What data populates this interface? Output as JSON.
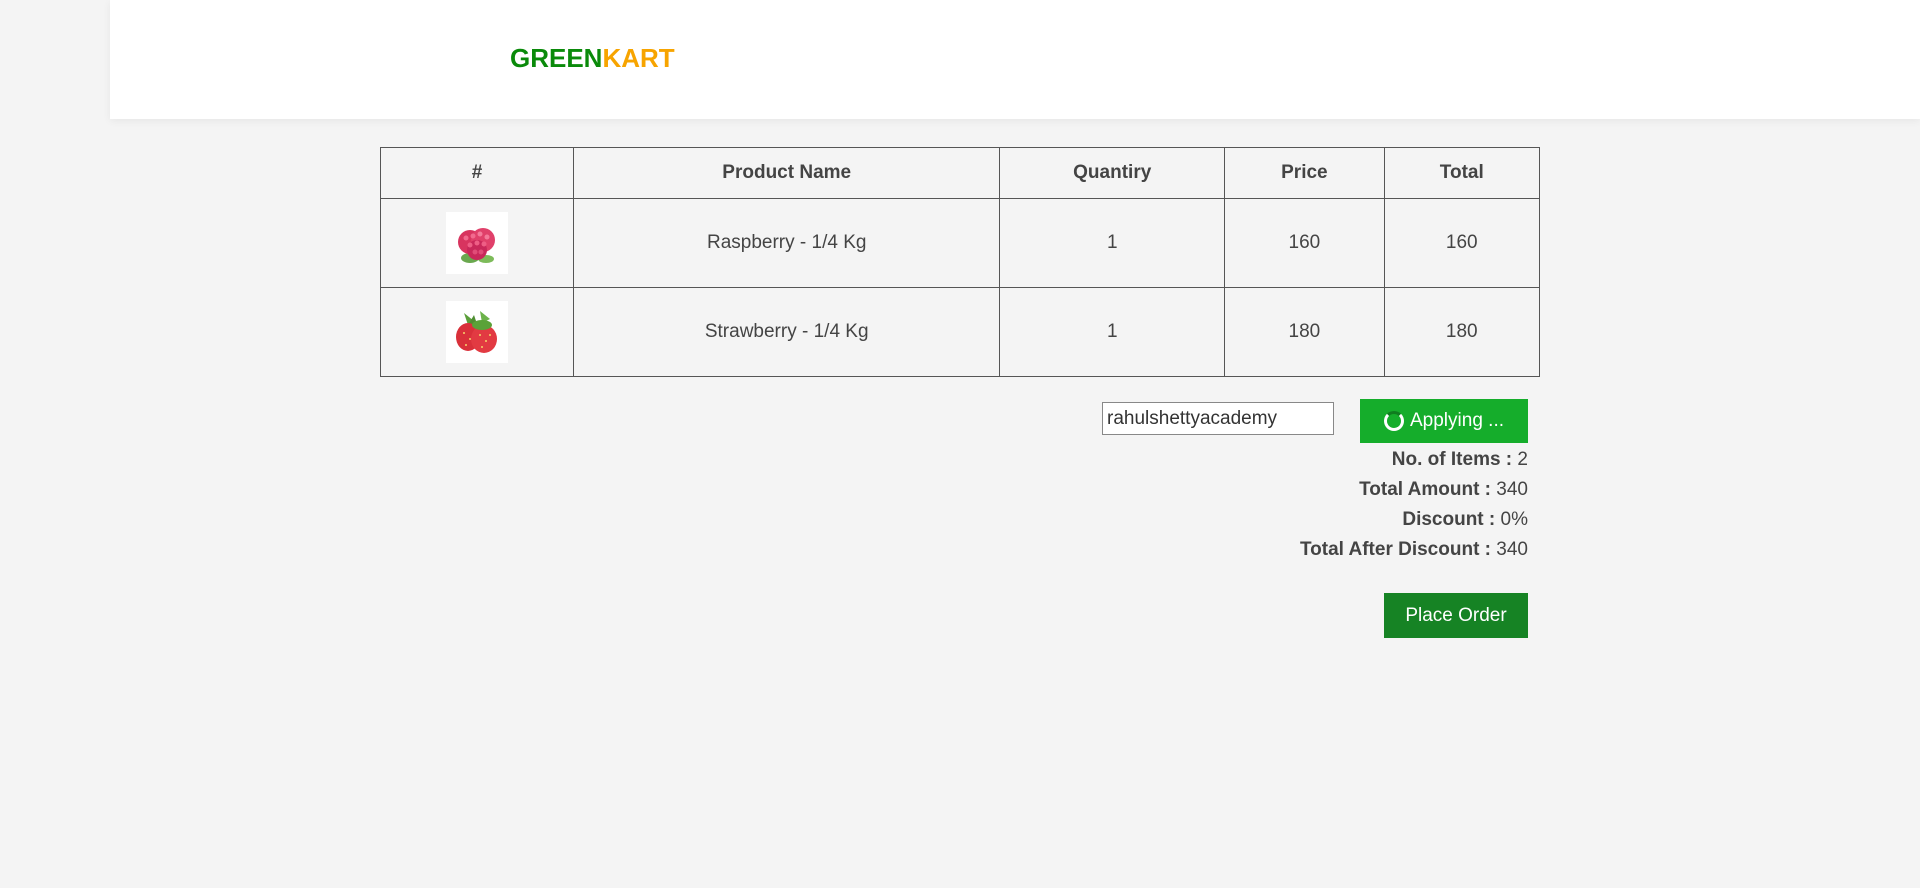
{
  "brand": {
    "part1": "GREEN",
    "part2": "KART",
    "color1": "#0a8a0a",
    "color2": "#f7a400"
  },
  "table": {
    "headers": [
      "#",
      "Product Name",
      "Quantiry",
      "Price",
      "Total"
    ],
    "rows": [
      {
        "image_icon": "raspberry-icon",
        "name": "Raspberry - 1/4 Kg",
        "quantity": "1",
        "price": "160",
        "total": "160"
      },
      {
        "image_icon": "strawberry-icon",
        "name": "Strawberry - 1/4 Kg",
        "quantity": "1",
        "price": "180",
        "total": "180"
      }
    ]
  },
  "promo": {
    "code_value": "rahulshettyacademy",
    "apply_label": "Applying ...",
    "apply_color": "#15ad2b"
  },
  "summary": {
    "items_label": "No. of Items :",
    "items_value": "2",
    "amount_label": "Total Amount :",
    "amount_value": "340",
    "discount_label": "Discount :",
    "discount_value": "0%",
    "after_label": "Total After Discount :",
    "after_value": "340"
  },
  "place_order_label": "Place Order",
  "place_order_color": "#168324"
}
